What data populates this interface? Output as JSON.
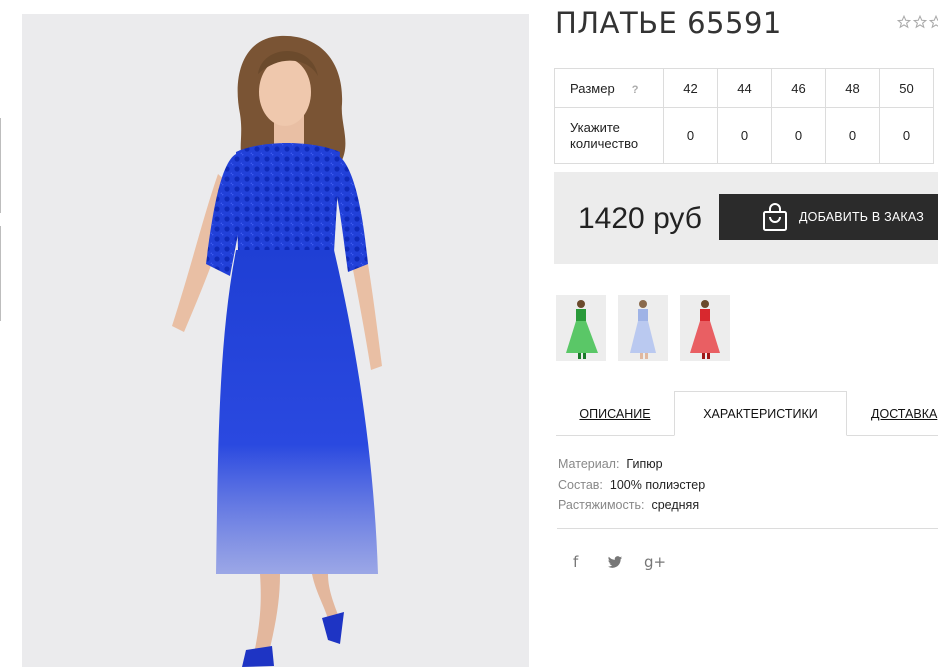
{
  "product": {
    "title": "ПЛАТЬЕ 65591",
    "rating_icons": [
      "star-outline-icon",
      "star-outline-icon",
      "star-outline-icon"
    ]
  },
  "size_table": {
    "size_label": "Размер",
    "help_mark": "?",
    "sizes": [
      "42",
      "44",
      "46",
      "48",
      "50"
    ],
    "qty_label_line1": "Укажите",
    "qty_label_line2": "количество",
    "quantities": [
      "0",
      "0",
      "0",
      "0",
      "0"
    ]
  },
  "price": {
    "value": "1420 руб",
    "button_label": "ДОБАВИТЬ В ЗАКАЗ",
    "button_icon": "shopping-bag-icon"
  },
  "color_variants": [
    "green",
    "light-blue",
    "red"
  ],
  "tabs": {
    "description": "ОПИСАНИЕ",
    "characteristics": "ХАРАКТЕРИСТИКИ",
    "delivery": "ДОСТАВКА"
  },
  "specs": [
    {
      "key": "Материал:",
      "value": "Гипюр"
    },
    {
      "key": "Состав:",
      "value": "100% полиэстер"
    },
    {
      "key": "Растяжимость:",
      "value": "средняя"
    }
  ],
  "social": {
    "facebook": "f",
    "twitter": "facebook-twitter-icon",
    "gplus": "g+"
  },
  "colors": {
    "dark": "#2b2b2b",
    "price_bg": "#ececec",
    "dress_blue": "#1f3fd4",
    "border": "#dcdcdc"
  }
}
